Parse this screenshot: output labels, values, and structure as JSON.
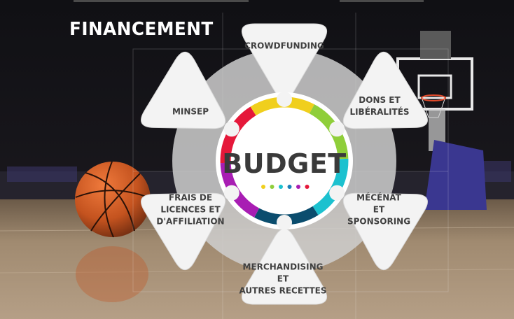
{
  "title": "FINANCEMENT",
  "center_label": "BUDGET",
  "colors": {
    "ring_segments": [
      "#f0cf1d",
      "#8fce3a",
      "#1cc1cf",
      "#0b4d6e",
      "#a81db3",
      "#e5183a"
    ],
    "dots": [
      "#f0cf1d",
      "#8fce3a",
      "#1cc1cf",
      "#1c7fb7",
      "#a81db3",
      "#e5183a"
    ],
    "petal_fill": "#f3f3f3",
    "label_text": "#404040"
  },
  "petals": [
    {
      "id": "crowdfunding",
      "lines": [
        "CROWDFUNDING"
      ]
    },
    {
      "id": "dons",
      "lines": [
        "DONS ET",
        "LIBÉRALITÉS"
      ]
    },
    {
      "id": "mecenat",
      "lines": [
        "MÉCÉNAT",
        "ET",
        "SPONSORING"
      ]
    },
    {
      "id": "merchandising",
      "lines": [
        "MERCHANDISING",
        "ET",
        "AUTRES RECETTES"
      ]
    },
    {
      "id": "frais",
      "lines": [
        "FRAIS DE",
        "LICENCES ET",
        "D'AFFILIATION"
      ]
    },
    {
      "id": "minsep",
      "lines": [
        "MINSEP"
      ]
    }
  ]
}
